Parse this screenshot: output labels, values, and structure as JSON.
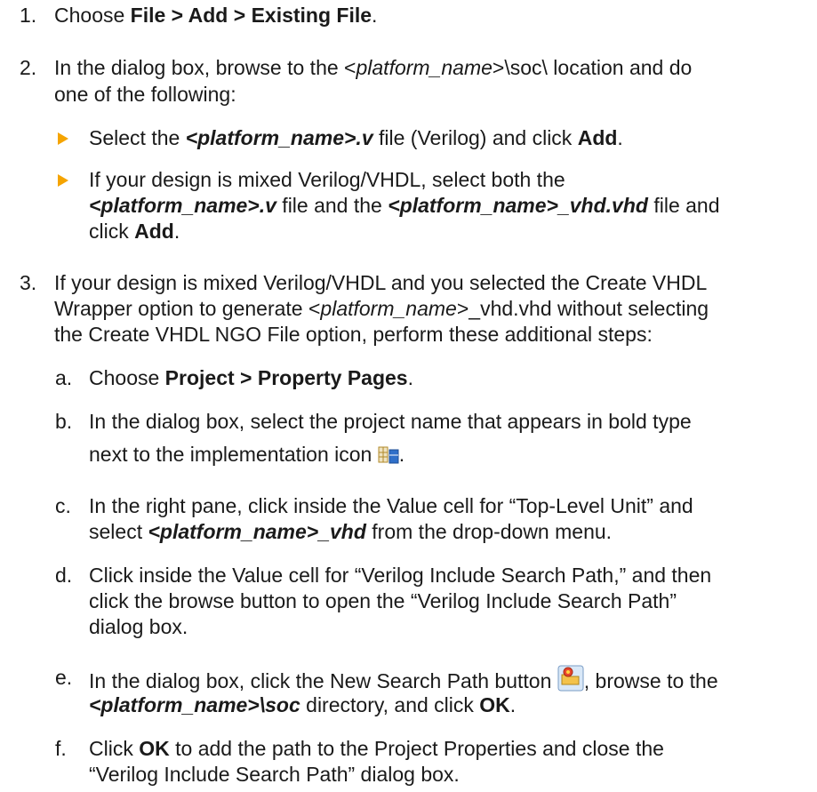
{
  "accent": "#f5a400",
  "step1": {
    "num": "1.",
    "pre": "Choose ",
    "menu": "File > Add > Existing File",
    "post": "."
  },
  "step2": {
    "num": "2.",
    "l1_pre": "In the dialog box, browse to the <",
    "l1_it": "platform_name",
    "l1_post": ">\\soc\\ location and do",
    "l2": "one of the following:",
    "b1": {
      "pre": "Select the ",
      "name": "<platform_name>.v",
      "mid": " file (Verilog) and click ",
      "btn": "Add",
      "post": "."
    },
    "b2": {
      "l1": "If your design is mixed Verilog/VHDL, select both the",
      "name1": "<platform_name>.v",
      "mid": " file and the ",
      "name2": "<platform_name>_vhd.vhd",
      "post": " file and",
      "l3_pre": "click ",
      "btn": "Add",
      "l3_post": "."
    }
  },
  "step3": {
    "num": "3.",
    "l1": "If your design is mixed Verilog/VHDL and you selected the Create VHDL",
    "l2_pre": "Wrapper option to generate <",
    "l2_it": "platform_name",
    "l2_post": ">_vhd.vhd without selecting",
    "l3": "the Create VHDL NGO File option, perform these additional steps:",
    "a": {
      "letter": "a.",
      "pre": "Choose ",
      "menu": "Project > Property Pages",
      "post": "."
    },
    "b": {
      "letter": "b.",
      "l1": "In the dialog box, select the project name that appears in bold type",
      "l2": "next to the implementation icon",
      "post": "."
    },
    "c": {
      "letter": "c.",
      "l1": "In the right pane, click inside the Value cell for “Top-Level Unit” and",
      "l2_pre": "select ",
      "name": "<platform_name>_vhd",
      "l2_post": " from the drop-down menu."
    },
    "d": {
      "letter": "d.",
      "l1": "Click inside the Value cell for “Verilog Include Search Path,” and then",
      "l2": "click the browse button to open the “Verilog Include Search Path”",
      "l3": "dialog box."
    },
    "e": {
      "letter": "e.",
      "l1_pre": "In the dialog box, click the New Search Path button",
      "l1_post": ", browse to the",
      "name": "<platform_name>\\soc",
      "l2_mid": " directory, and click ",
      "btn": "OK",
      "l2_post": "."
    },
    "f": {
      "letter": "f.",
      "pre": "Click ",
      "btn": "OK",
      "l1_post": " to add the path to the Project Properties and close the",
      "l2": "“Verilog Include Search Path” dialog box."
    }
  }
}
